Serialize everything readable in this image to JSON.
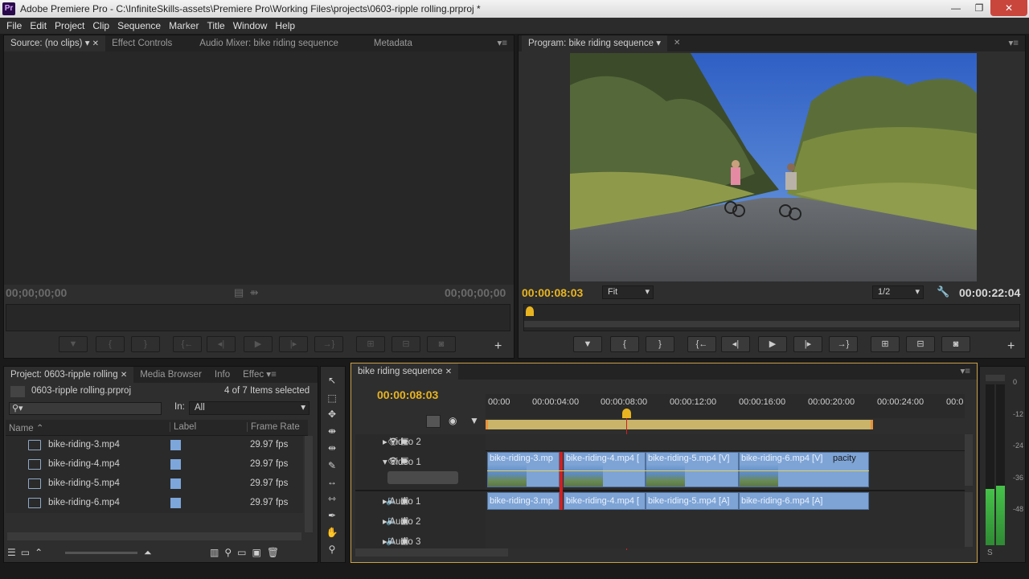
{
  "window": {
    "app_logo": "Pr",
    "title": "Adobe Premiere Pro - C:\\InfiniteSkills-assets\\Premiere Pro\\Working Files\\projects\\0603-ripple rolling.prproj *",
    "min": "—",
    "max": "❐",
    "close": "✕"
  },
  "menu": [
    "File",
    "Edit",
    "Project",
    "Clip",
    "Sequence",
    "Marker",
    "Title",
    "Window",
    "Help"
  ],
  "source_panel": {
    "tabs": [
      "Source: (no clips)",
      "Effect Controls",
      "Audio Mixer: bike riding sequence",
      "Metadata"
    ],
    "timecode_left": "00;00;00;00",
    "timecode_right": "00;00;00;00"
  },
  "program_panel": {
    "tab": "Program: bike riding sequence",
    "timecode_left": "00:00:08:03",
    "zoom": "Fit",
    "resolution": "1/2",
    "timecode_right": "00:00:22:04"
  },
  "project_panel": {
    "tabs": [
      "Project: 0603-ripple rolling",
      "Media Browser",
      "Info",
      "Effec"
    ],
    "file": "0603-ripple rolling.prproj",
    "selection": "4 of 7 Items selected",
    "in_label": "In:",
    "in_value": "All",
    "columns": [
      "Name",
      "Label",
      "Frame Rate"
    ],
    "items": [
      {
        "name": "bike-riding-3.mp4",
        "fps": "29.97 fps"
      },
      {
        "name": "bike-riding-4.mp4",
        "fps": "29.97 fps"
      },
      {
        "name": "bike-riding-5.mp4",
        "fps": "29.97 fps"
      },
      {
        "name": "bike-riding-6.mp4",
        "fps": "29.97 fps"
      }
    ]
  },
  "timeline": {
    "tab": "bike riding sequence",
    "timecode": "00:00:08:03",
    "ruler": [
      "00:00",
      "00:00:04:00",
      "00:00:08:00",
      "00:00:12:00",
      "00:00:16:00",
      "00:00:20:00",
      "00:00:24:00",
      "00:0"
    ],
    "tracks": [
      "Video 2",
      "Video 1",
      "Audio 1",
      "Audio 2",
      "Audio 3"
    ],
    "video_clips": [
      "bike-riding-3.mp",
      "bike-riding-4.mp4 [",
      "bike-riding-5.mp4 [V]",
      "bike-riding-6.mp4 [V]"
    ],
    "opacity_label": "pacity",
    "audio_clips": [
      "bike-riding-3.mp",
      "bike-riding-4.mp4 [",
      "bike-riding-5.mp4 [A]",
      "bike-riding-6.mp4 [A]"
    ]
  },
  "audio_meter": {
    "labels": [
      "0",
      "-12",
      "-24",
      "-36",
      "-48"
    ],
    "bottom": "S"
  },
  "colors": {
    "accent_timecode": "#e8b420",
    "clip_blue": "#7ea4d6",
    "playhead_red": "#d02020"
  }
}
